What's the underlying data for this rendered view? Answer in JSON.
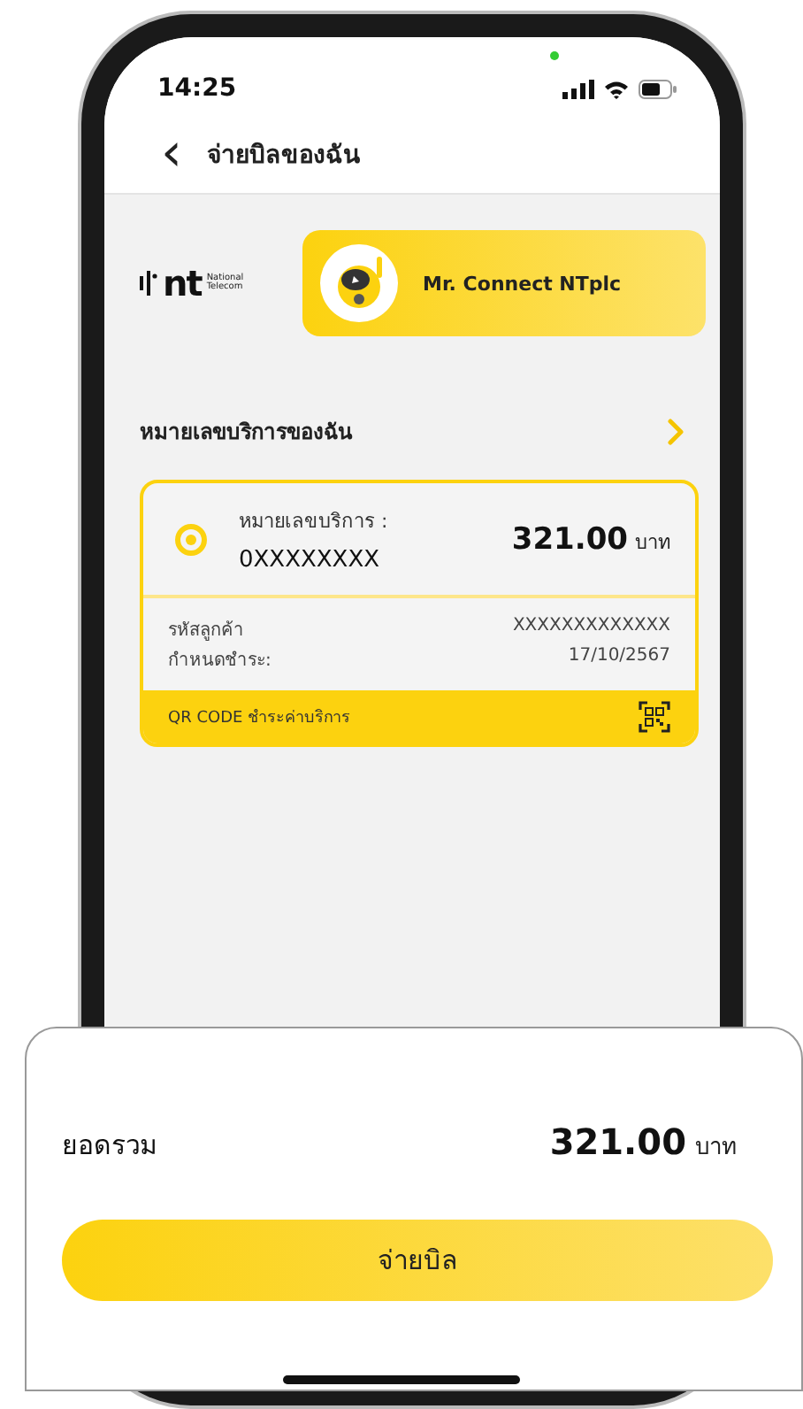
{
  "status_bar": {
    "time": "14:25"
  },
  "header": {
    "back": "‹",
    "title": "จ่ายบิลของฉัน"
  },
  "brand": {
    "logo": "nt",
    "logo_caption": "National Telecom",
    "mascot_name": "Mr. Connect NTplc"
  },
  "section": {
    "title": "หมายเลขบริการของฉัน"
  },
  "bills": [
    {
      "selected": true,
      "number_label": "หมายเลขบริการ :",
      "number": "0XXXXXXXX",
      "amount": "321.00",
      "currency": "บาท",
      "customer_label": "รหัสลูกค้า",
      "customer_id": "XXXXXXXXXXXXX",
      "due_label": "กำหนดชำระ:",
      "due_date": "17/10/2567",
      "qr_label": "QR CODE ชำระค่าบริการ"
    }
  ],
  "summary": {
    "label": "ยอดรวม",
    "amount": "321.00",
    "currency": "บาท",
    "button": "จ่ายบิล"
  }
}
